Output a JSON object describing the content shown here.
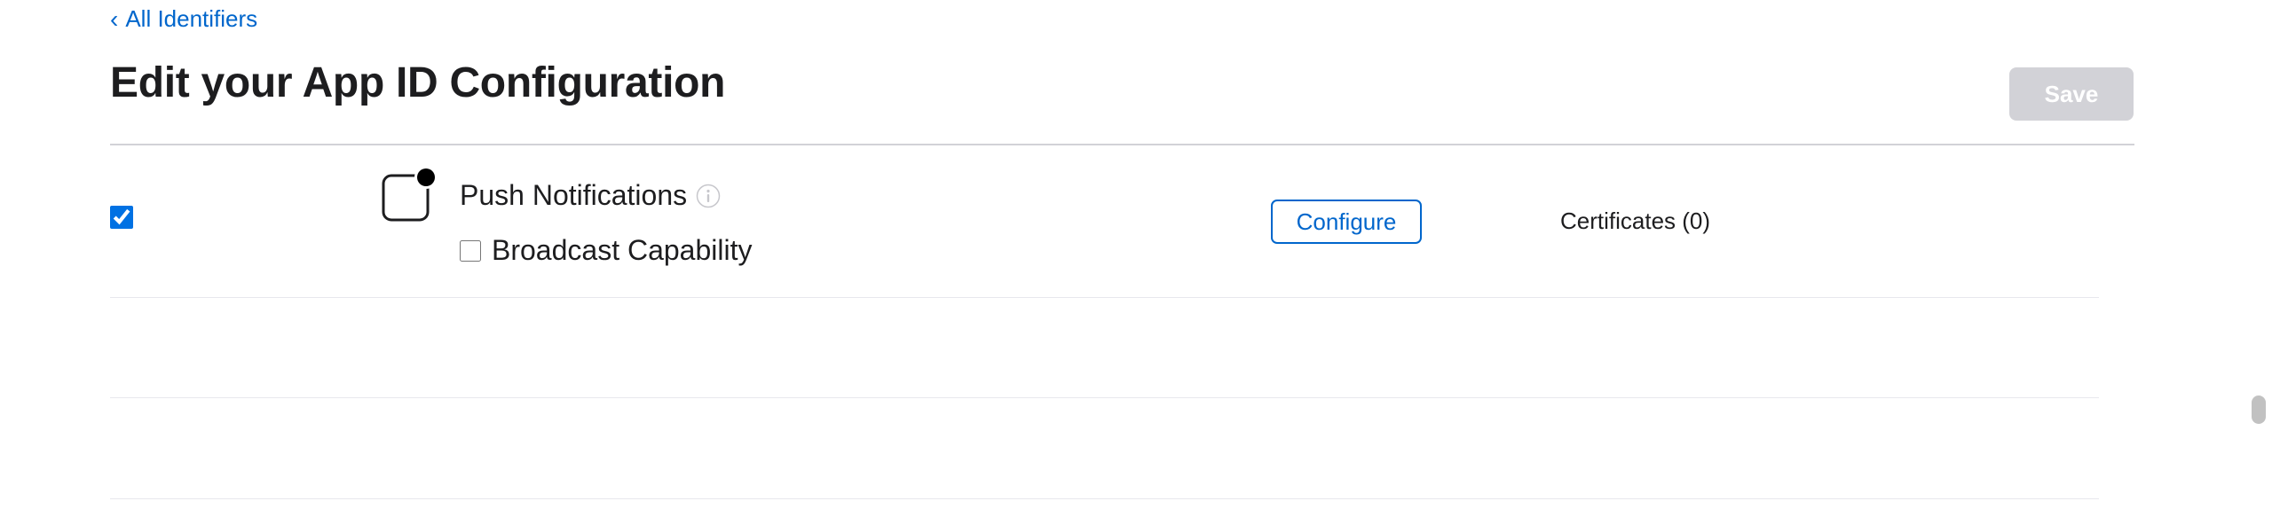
{
  "nav": {
    "back_label": "All Identifiers"
  },
  "header": {
    "title": "Edit your App ID Configuration",
    "save_label": "Save"
  },
  "capability": {
    "enabled": true,
    "name": "Push Notifications",
    "icon": "push-notification-icon",
    "info_icon": "info-icon",
    "sub_option_label": "Broadcast Capability",
    "sub_option_checked": false,
    "configure_label": "Configure",
    "certificates_label": "Certificates (0)"
  },
  "colors": {
    "link": "#0066cc",
    "checkbox_accent": "#0071e3",
    "save_disabled_bg": "#d2d2d7"
  }
}
